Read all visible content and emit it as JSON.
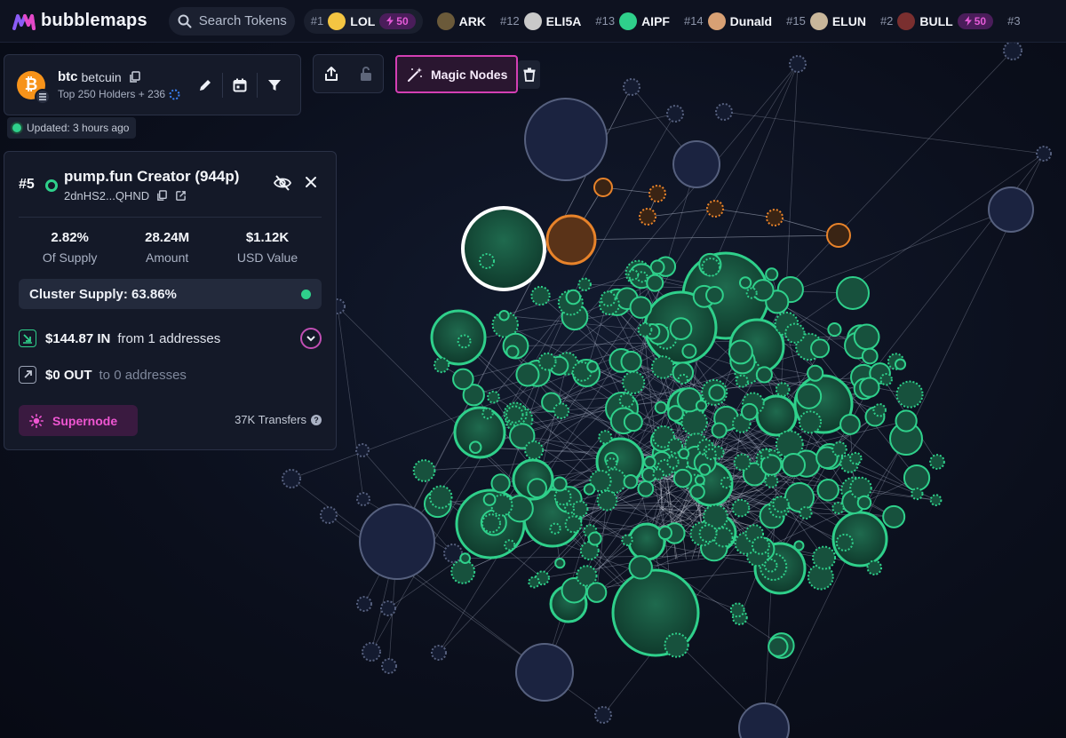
{
  "app": {
    "name": "bubblemaps"
  },
  "search": {
    "placeholder": "Search Tokens"
  },
  "ticker": [
    {
      "rank": "#1",
      "symbol": "LOL",
      "avatar": "laughing-face",
      "boost": "50",
      "color": "#f4c542"
    },
    {
      "rank": "",
      "symbol": "ARK",
      "avatar": "ark-logo",
      "boost": "",
      "color": "#6b5a3a"
    },
    {
      "rank": "#12",
      "symbol": "ELI5A",
      "avatar": "eli5a-logo",
      "boost": "",
      "color": "#c9c9c9"
    },
    {
      "rank": "#13",
      "symbol": "AIPF",
      "avatar": "aipf-logo",
      "boost": "",
      "color": "#2fd08b"
    },
    {
      "rank": "#14",
      "symbol": "Dunald",
      "avatar": "dunald-avatar",
      "boost": "",
      "color": "#d8a074"
    },
    {
      "rank": "#15",
      "symbol": "ELUN",
      "avatar": "elun-avatar",
      "boost": "",
      "color": "#c8b69a"
    },
    {
      "rank": "#2",
      "symbol": "BULL",
      "avatar": "bull-avatar",
      "boost": "50",
      "color": "#7a2f2f"
    },
    {
      "rank": "#3",
      "symbol": "",
      "avatar": "",
      "boost": "",
      "color": "#555"
    }
  ],
  "token": {
    "symbol": "btc",
    "name": "betcuin",
    "holders": "Top 250 Holders + 236",
    "updated": "Updated: 3 hours ago"
  },
  "toolbar": {
    "magic_label": "Magic Nodes"
  },
  "details": {
    "rank": "#5",
    "title": "pump.fun Creator (944p)",
    "address": "2dnHS2...QHND",
    "stats": [
      {
        "value": "2.82%",
        "label": "Of Supply"
      },
      {
        "value": "28.24M",
        "label": "Amount"
      },
      {
        "value": "$1.12K",
        "label": "USD Value"
      }
    ],
    "cluster_supply": "Cluster Supply: 63.86%",
    "inflow": {
      "amount": "$144.87 IN",
      "text": "from 1 addresses"
    },
    "outflow": {
      "amount": "$0 OUT",
      "text": "to 0 addresses"
    },
    "supernode_label": "Supernode",
    "transfers": "37K Transfers"
  },
  "colors": {
    "accent": "#d43fb4",
    "node_green": "#2fd08b",
    "node_orange": "#e8832a",
    "node_blue": "#1e2744"
  }
}
